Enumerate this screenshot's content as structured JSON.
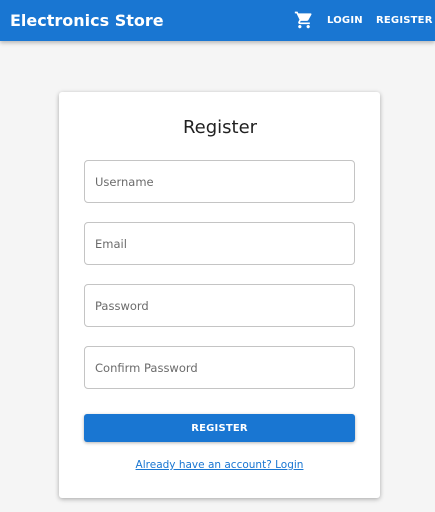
{
  "header": {
    "brand": "Electronics Store",
    "cart_icon": "shopping-cart-icon",
    "login_label": "LOGIN",
    "register_label": "REGISTER"
  },
  "form": {
    "title": "Register",
    "fields": {
      "username": {
        "placeholder": "Username",
        "value": ""
      },
      "email": {
        "placeholder": "Email",
        "value": ""
      },
      "password": {
        "placeholder": "Password",
        "value": ""
      },
      "confirm_password": {
        "placeholder": "Confirm Password",
        "value": ""
      }
    },
    "submit_label": "REGISTER",
    "login_link": "Already have an account? Login"
  },
  "colors": {
    "primary": "#1976d2",
    "background": "#f5f5f5",
    "card": "#ffffff"
  }
}
